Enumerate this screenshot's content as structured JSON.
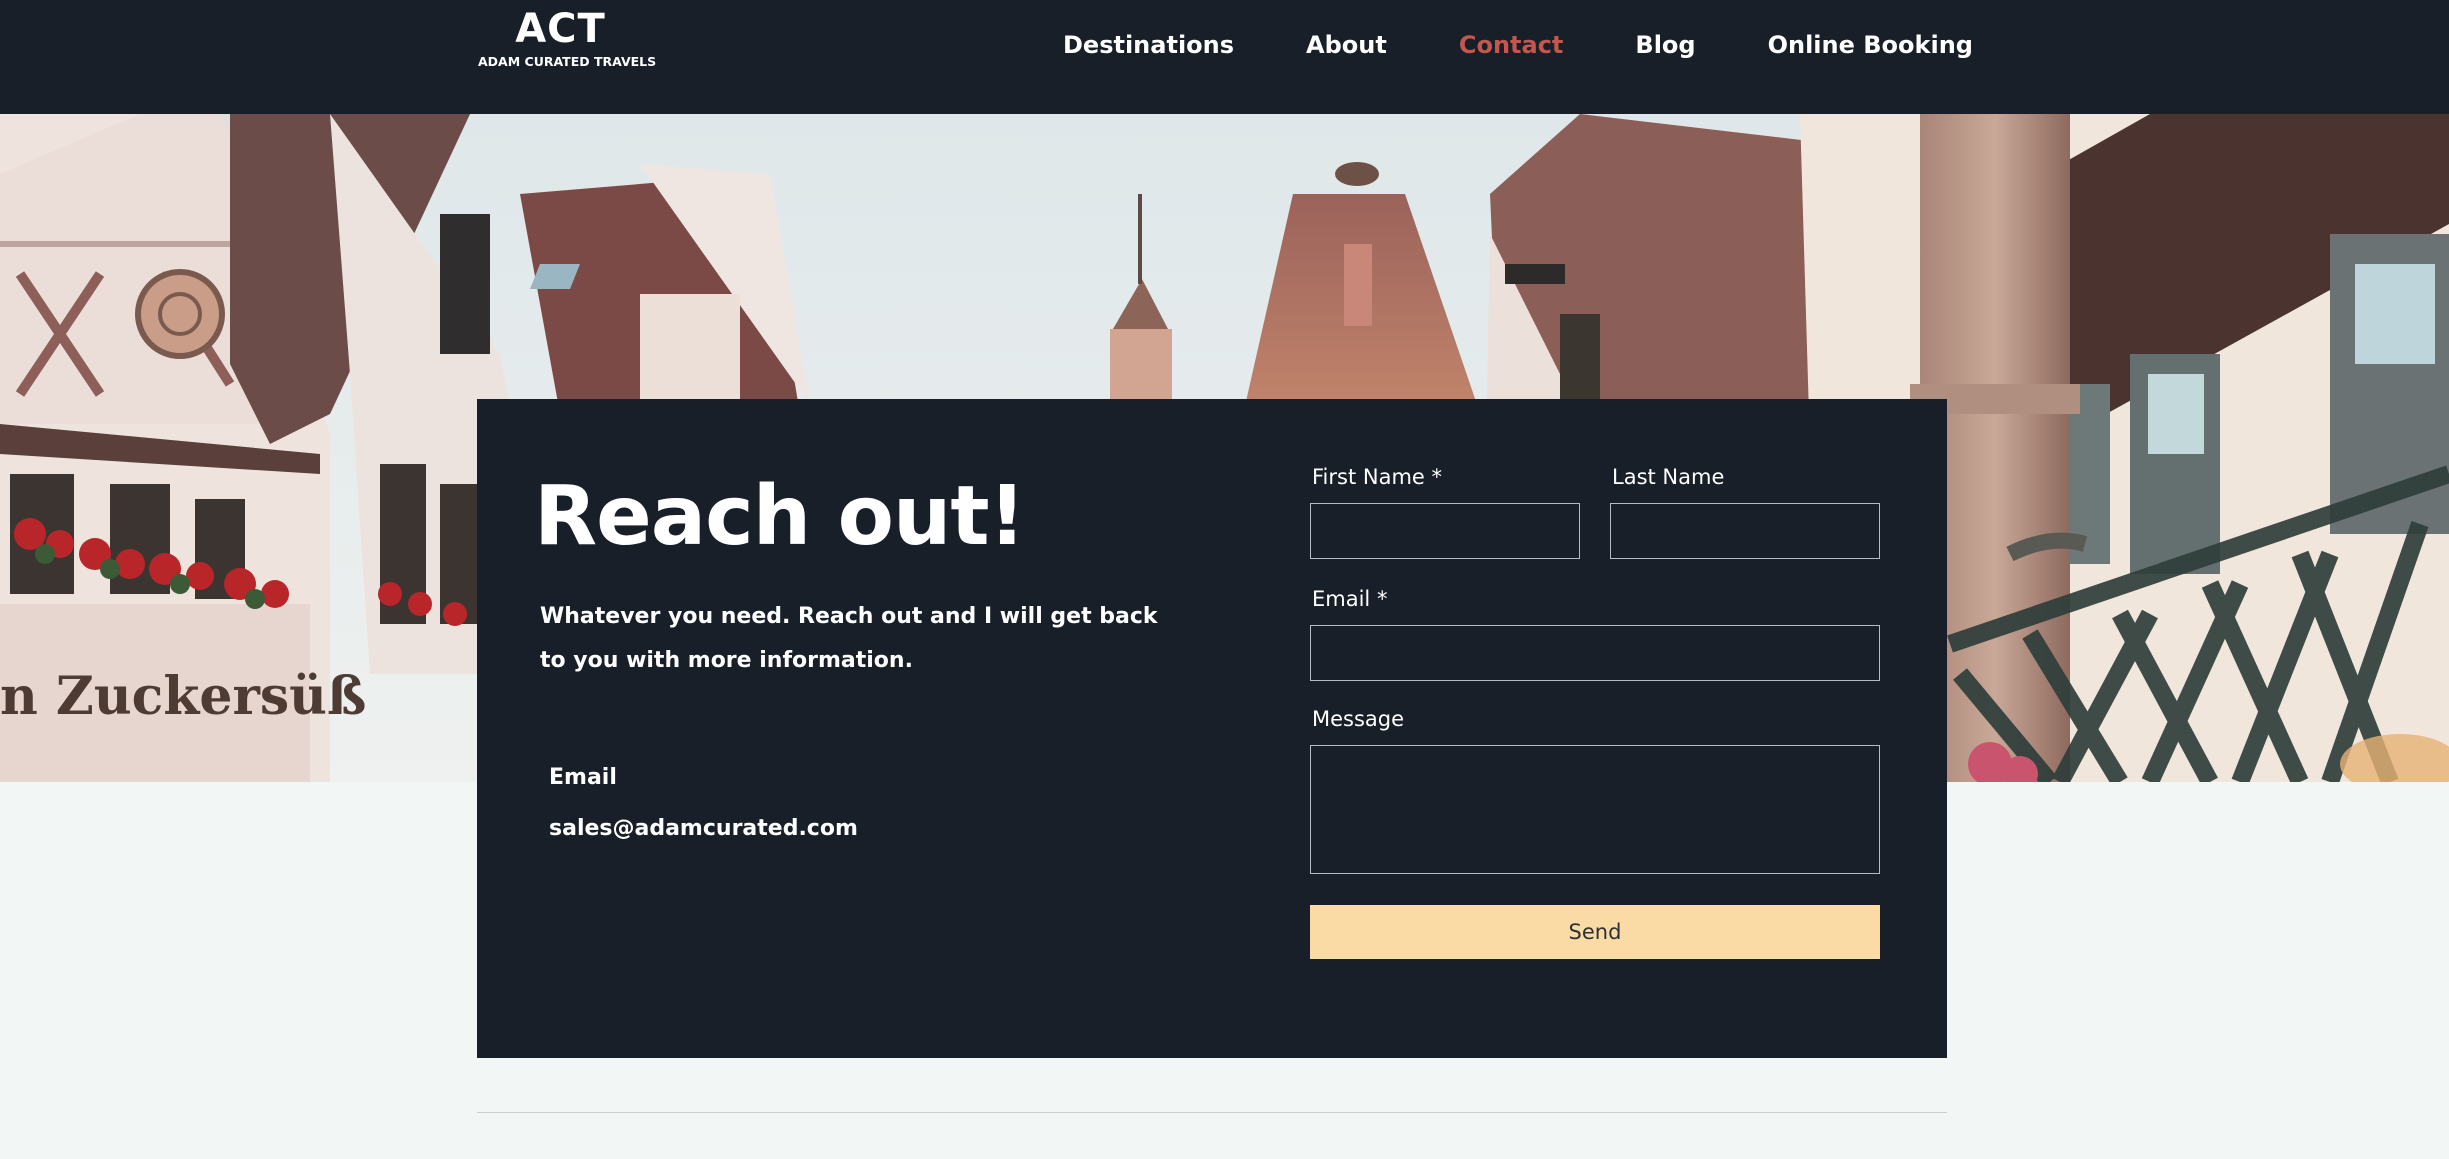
{
  "header": {
    "logo_mark": "ACT",
    "logo_tagline": "ADAM CURATED TRAVELS",
    "nav": [
      {
        "label": "Destinations",
        "active": false
      },
      {
        "label": "About",
        "active": false
      },
      {
        "label": "Contact",
        "active": true
      },
      {
        "label": "Blog",
        "active": false
      },
      {
        "label": "Online Booking",
        "active": false
      }
    ],
    "active_color": "#c4564c"
  },
  "contact": {
    "heading": "Reach out!",
    "intro": "Whatever you need. Reach out and I will get back to you with more information.",
    "email_label": "Email",
    "email_value": "sales@adamcurated.com"
  },
  "form": {
    "first_name_label": "First Name *",
    "first_name_value": "",
    "last_name_label": "Last Name",
    "last_name_value": "",
    "email_label": "Email *",
    "email_value": "",
    "message_label": "Message",
    "message_value": "",
    "send_label": "Send"
  },
  "hero": {
    "shop_sign": "n Zuckersüß"
  },
  "colors": {
    "header_bg": "#181f28",
    "card_bg": "#181f28",
    "button_bg": "#fadba6",
    "page_bg": "#f2f6f5"
  }
}
